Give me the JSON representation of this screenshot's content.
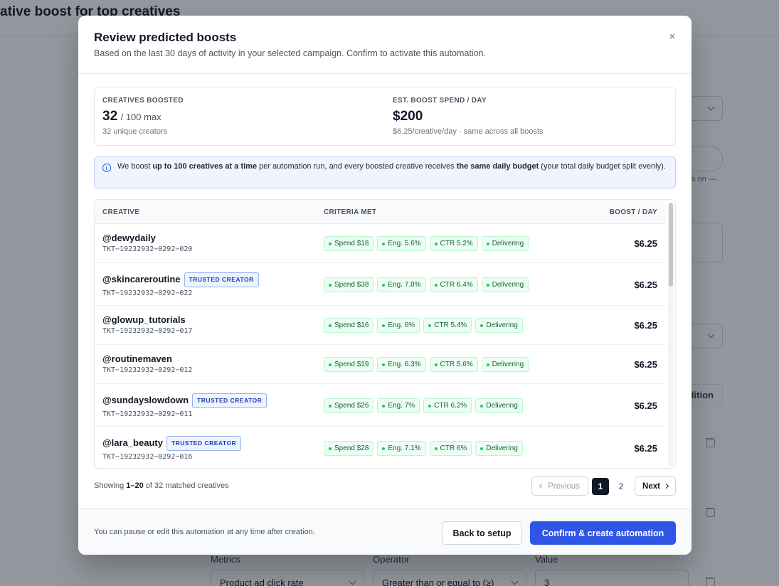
{
  "background": {
    "page_title": "ative boost for top creatives",
    "fragment_text": "s on —",
    "add_condition_fragment": "dition",
    "metrics_label": "Metrics",
    "operator_label": "Operator",
    "value_label": "Value",
    "metrics_value": "Product ad click rate",
    "operator_value": "Greater than or equal to (≥)",
    "value_value": "3"
  },
  "modal": {
    "title": "Review predicted boosts",
    "subtitle": "Based on the last 30 days of activity in your selected campaign. Confirm to activate this automation.",
    "close_glyph": "×",
    "stats": {
      "creatives_label": "CREATIVES BOOSTED",
      "creatives_value": "32",
      "creatives_max": "/ 100 max",
      "creatives_note": "32 unique creators",
      "spend_label": "EST. BOOST SPEND / DAY",
      "spend_value": "$200",
      "spend_note": "$6.25/creative/day · same across all boosts"
    },
    "info": {
      "part1": "We boost ",
      "bold1": "up to 100 creatives at a time",
      "part2": " per automation run, and every boosted creative receives ",
      "bold2": "the same daily budget",
      "part3": " (your total daily budget split evenly)."
    },
    "table": {
      "headers": {
        "creative": "CREATIVE",
        "criteria": "CRITERIA MET",
        "boost": "BOOST / DAY"
      },
      "rows": [
        {
          "handle": "@dewydaily",
          "trusted": "",
          "id": "TKT−19232932−0292−020",
          "tags": [
            "Spend $18",
            "Eng. 5.6%",
            "CTR 5.2%",
            "Delivering"
          ],
          "amount": "$6.25"
        },
        {
          "handle": "@skincareroutine",
          "trusted": "TRUSTED CREATOR",
          "id": "TKT−19232932−0292−022",
          "tags": [
            "Spend $38",
            "Eng. 7.8%",
            "CTR 6.4%",
            "Delivering"
          ],
          "amount": "$6.25"
        },
        {
          "handle": "@glowup_tutorials",
          "trusted": "",
          "id": "TKT−19232932−0292−017",
          "tags": [
            "Spend $16",
            "Eng. 6%",
            "CTR 5.4%",
            "Delivering"
          ],
          "amount": "$6.25"
        },
        {
          "handle": "@routinemaven",
          "trusted": "",
          "id": "TKT−19232932−0292−012",
          "tags": [
            "Spend $19",
            "Eng. 6.3%",
            "CTR 5.6%",
            "Delivering"
          ],
          "amount": "$6.25"
        },
        {
          "handle": "@sundayslowdown",
          "trusted": "TRUSTED CREATOR",
          "id": "TKT−19232932−0292−011",
          "tags": [
            "Spend $26",
            "Eng. 7%",
            "CTR 6.2%",
            "Delivering"
          ],
          "amount": "$6.25"
        },
        {
          "handle": "@lara_beauty",
          "trusted": "TRUSTED CREATOR",
          "id": "TKT−19232932−0292−016",
          "tags": [
            "Spend $28",
            "Eng. 7.1%",
            "CTR 6%",
            "Delivering"
          ],
          "amount": "$6.25"
        }
      ]
    },
    "pagination": {
      "showing_prefix": "Showing ",
      "showing_range": "1–20",
      "showing_suffix": " of 32 matched creatives",
      "prev": "Previous",
      "page1": "1",
      "page2": "2",
      "next": "Next"
    },
    "footer": {
      "note": "You can pause or edit this automation at any time after creation.",
      "back": "Back to setup",
      "confirm": "Confirm & create automation"
    }
  },
  "colors": {
    "primary": "#2e55e6",
    "tag_bg": "#ecfdf3",
    "tag_text": "#166534",
    "trusted_text": "#1e40af"
  }
}
